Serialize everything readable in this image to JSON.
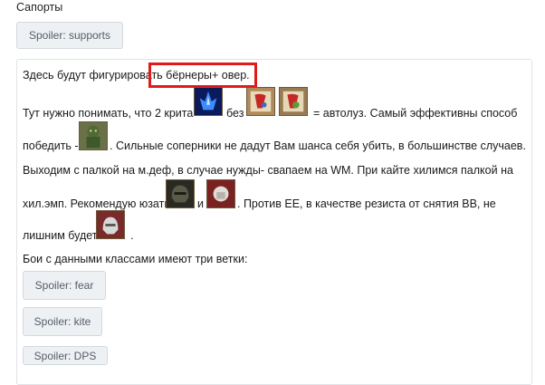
{
  "section_title": "Сапорты",
  "spoilers": {
    "supports": "Spoiler: supports",
    "fear": "Spoiler: fear",
    "kite": "Spoiler: kite",
    "dps": "Spoiler: DPS"
  },
  "post": {
    "line1_prefix": "Здесь будут фигурироват",
    "line1_highlight": "ь бёрнеры+ овер.",
    "line2_a": "Тут нужно понимать, что 2 крита",
    "line2_b": "без",
    "line2_c": "= автолуз. Самый эффективны способ",
    "line3_a": "победить -",
    "line3_b": ". Сильные соперники не дадут Вам шанса себя убить, в большинстве случаев.",
    "line4": "Выходим с палкой на м.деф, в случае нужды- свапаем на WM. При кайте хилимся палкой на",
    "line5_a": "хил.эмп. Рекомендую юзать",
    "line5_b": "и",
    "line5_c": ". Против ЕЕ, в качестве резиста от снятия ВВ, не",
    "line6_a": "лишним будет",
    "line6_b": ".",
    "line7": "Бои с данными классами имеют три ветки:"
  },
  "icons": [
    "blue-flame-skill-icon",
    "scroll-red-icon",
    "scroll-green-icon",
    "orc-warrior-icon",
    "dark-helmet-icon",
    "fist-skill-icon",
    "silver-helmet-icon"
  ]
}
